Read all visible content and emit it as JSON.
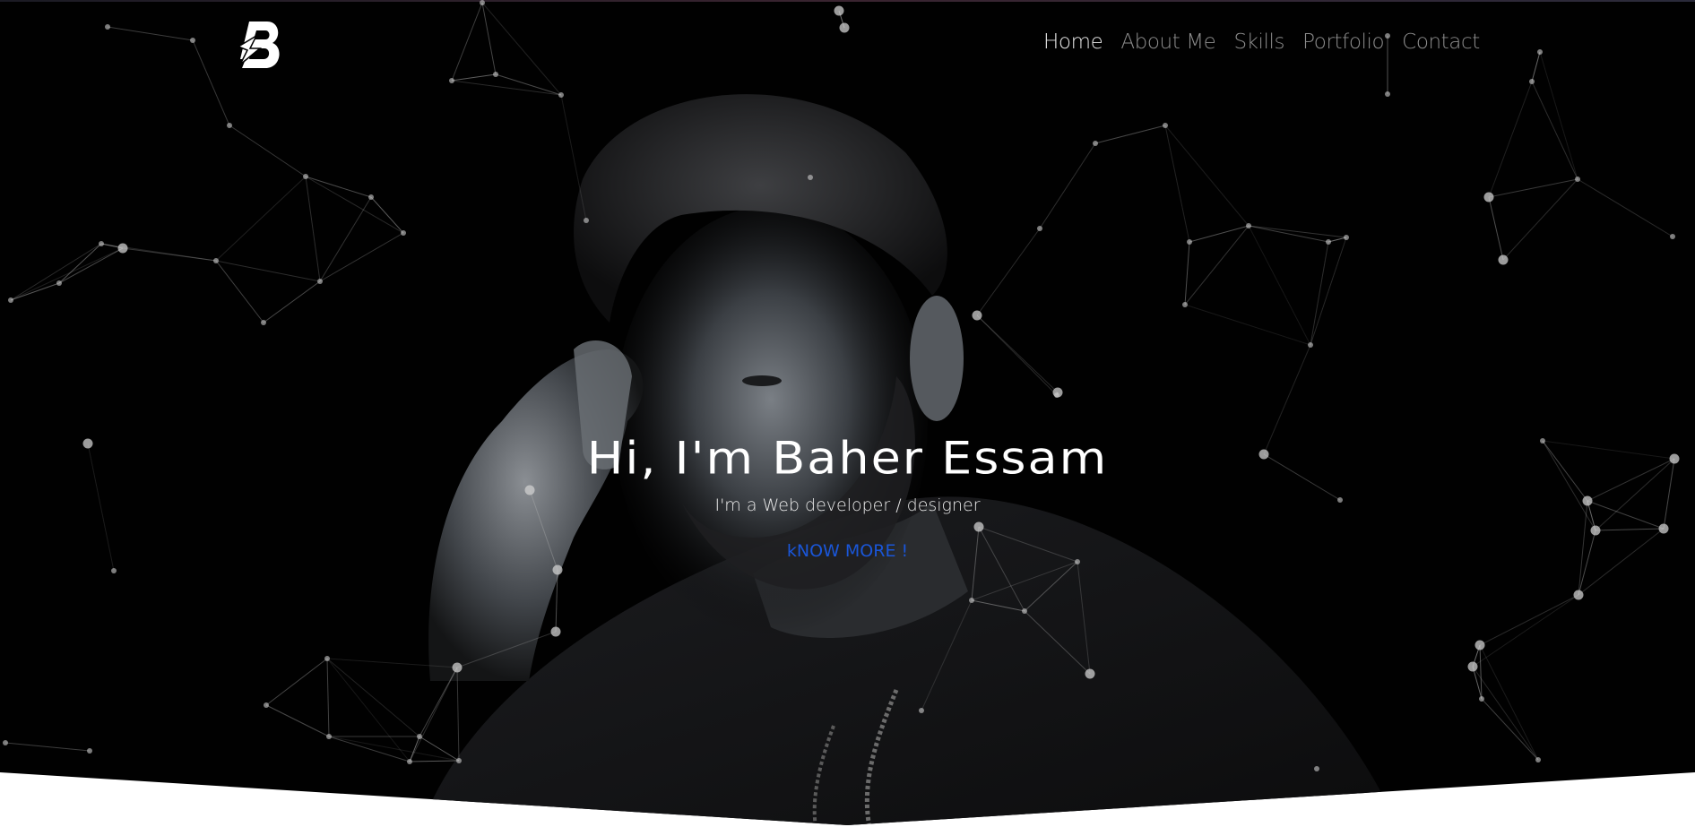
{
  "brand": {
    "logo_letter": "B"
  },
  "nav": {
    "items": [
      {
        "label": "Home",
        "active": true
      },
      {
        "label": "About Me",
        "active": false
      },
      {
        "label": "Skills",
        "active": false
      },
      {
        "label": "Portfolio",
        "active": false
      },
      {
        "label": "Contact",
        "active": false
      }
    ]
  },
  "hero": {
    "headline": "Hi, I'm Baher Essam",
    "subtitle": "I'm a Web developer / designer",
    "cta_label": "kNOW MORE !"
  },
  "colors": {
    "background": "#010101",
    "nav_active": "#e6e6e6",
    "nav_inactive": "#8d8d8d",
    "cta": "#1a56d8",
    "page": "#ffffff"
  }
}
